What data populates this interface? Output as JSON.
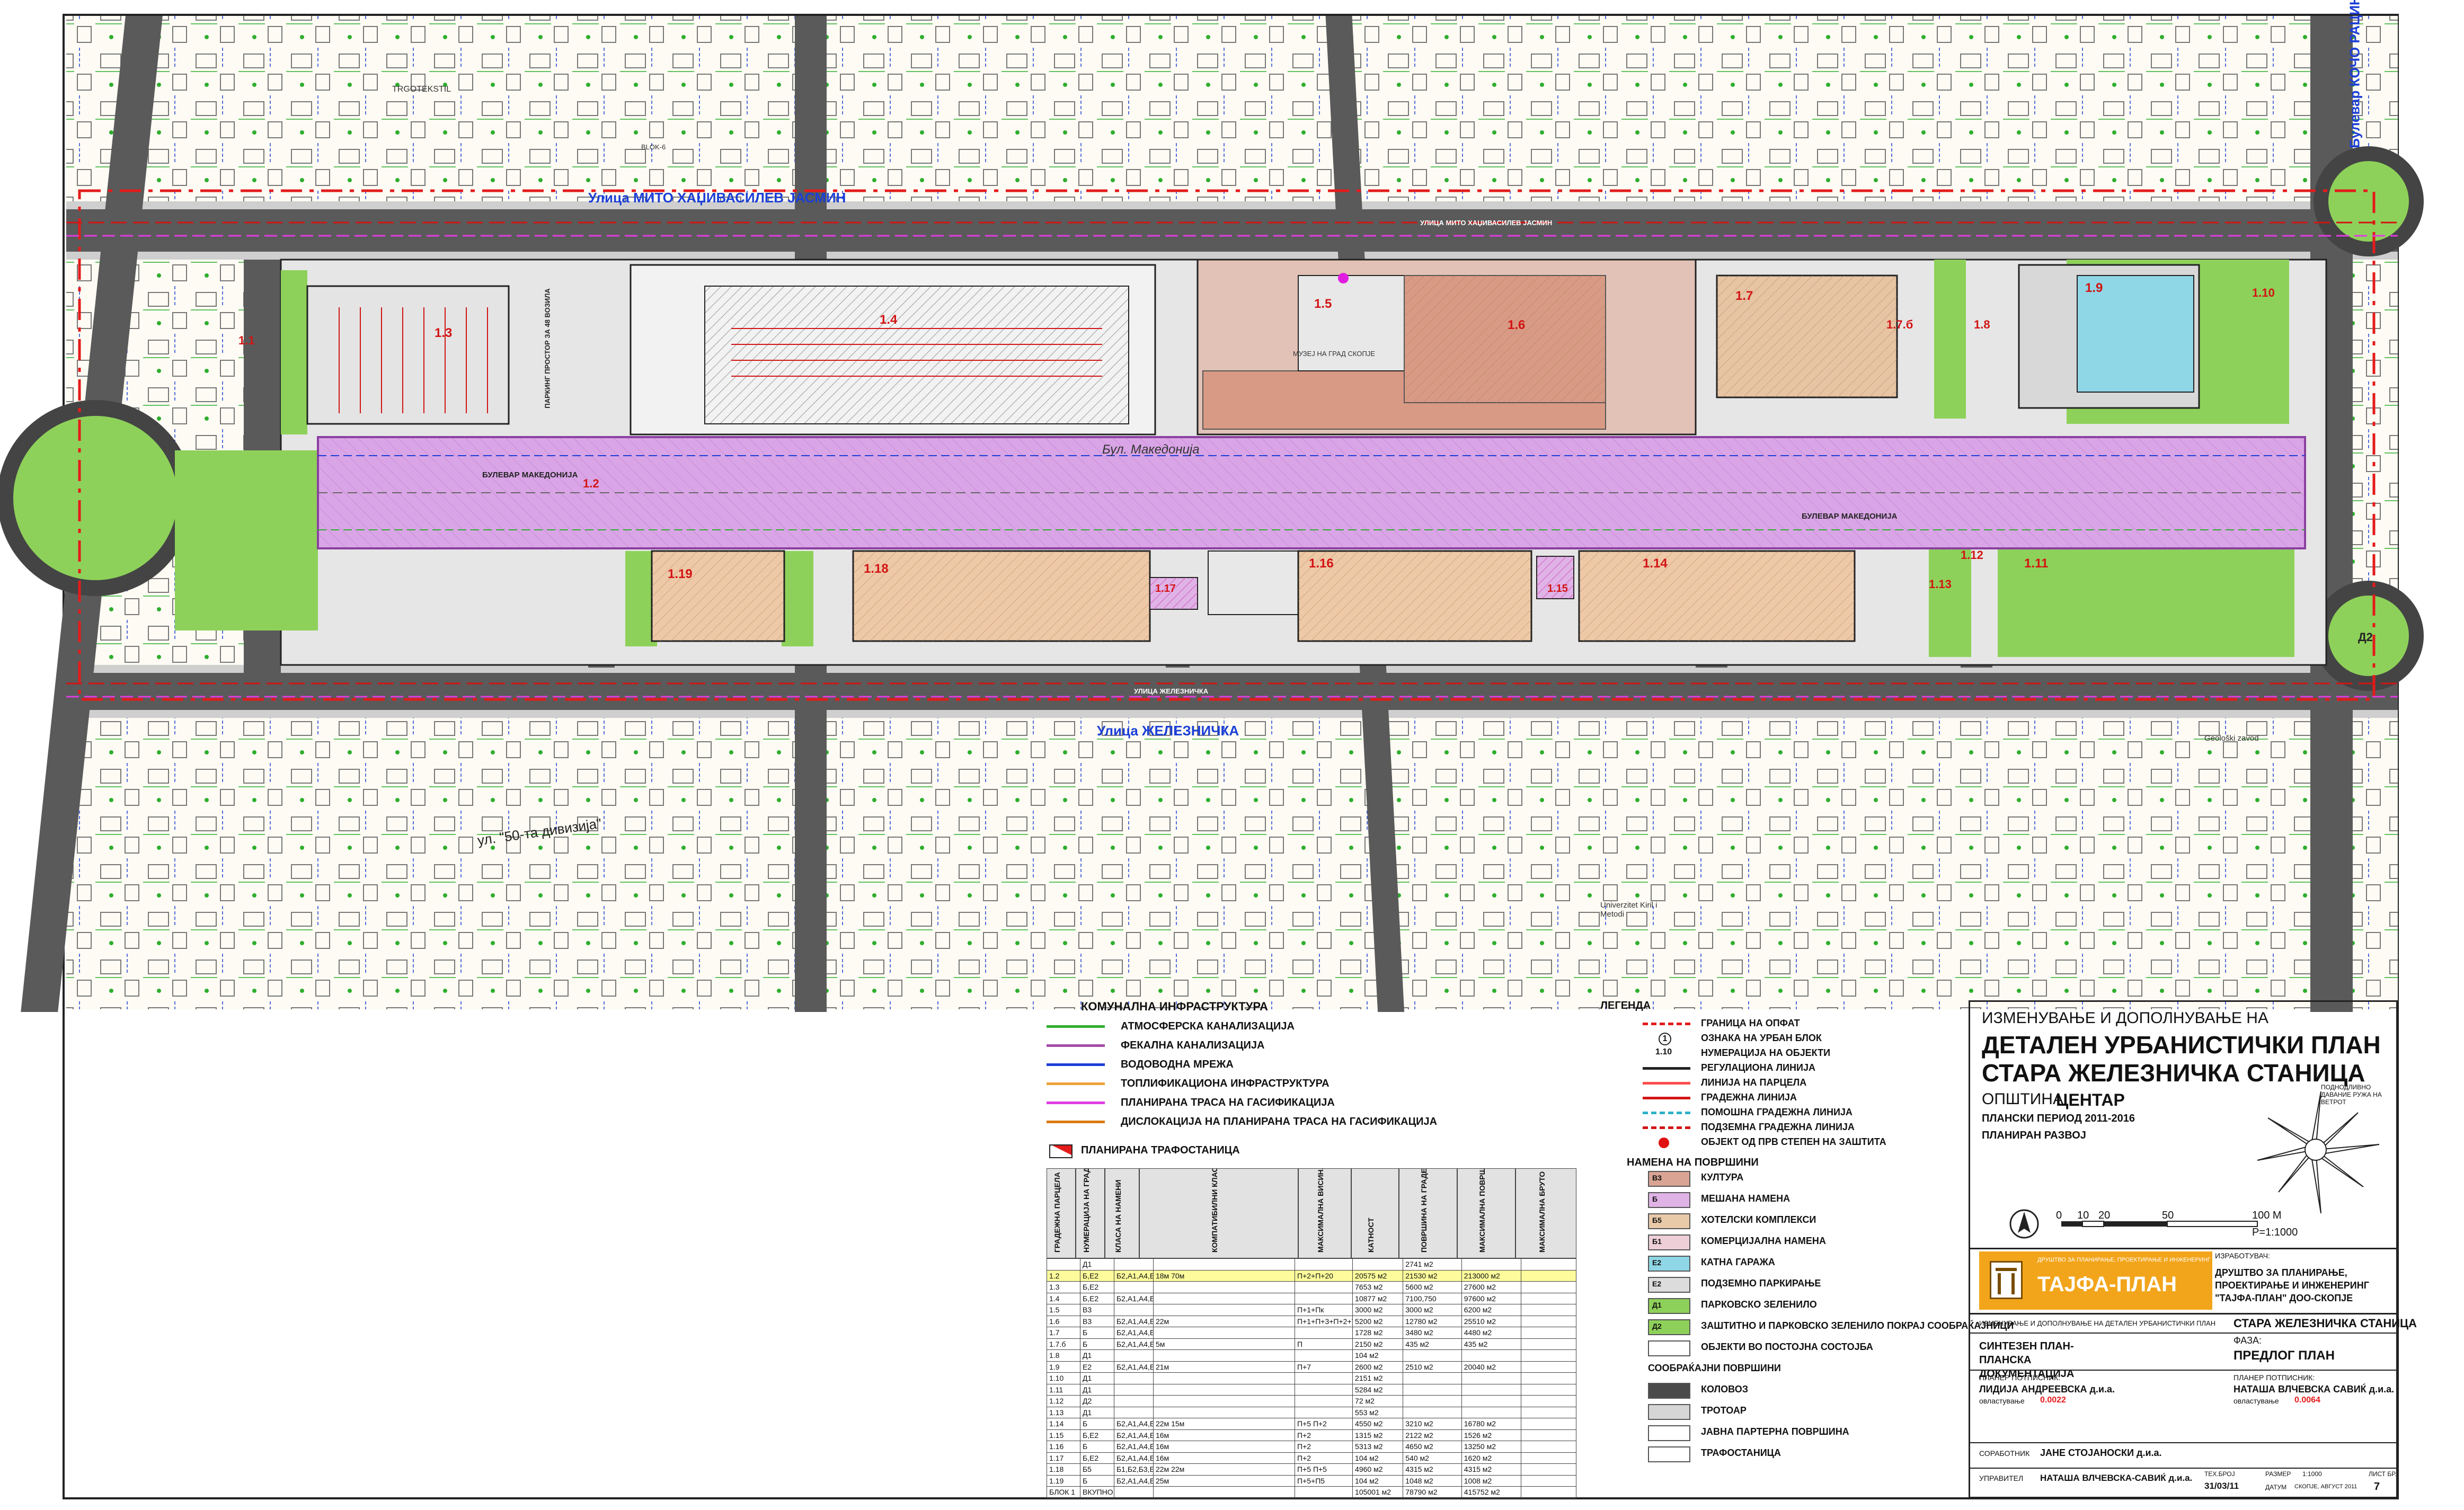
{
  "streets": {
    "north": "Улица МИТО ХАЏИВАСИЛЕВ ЈАСМИН",
    "north_small": "УЛИЦА МИТО ХАЏИВАСИЛЕВ ЈАСМИН",
    "boulevard": "Бул. Македонија",
    "boulevard_caps": "БУЛЕВАР МАКЕДОНИЈА",
    "south": "Улица ЖЕЛЕЗНИЧКА",
    "south_small": "УЛИЦА ЖЕЛЕЗНИЧКА",
    "southwest": "ул. \"50-та дивизија\"",
    "east_blvd": "Булевар КОЧО РАЦИН",
    "west_side": "ПАРКИНГ ПРОСТОР ЗА 48 ВОЗИЛА"
  },
  "map_labels": {
    "trgotekstil": "TRGOTEKSTIL",
    "museum": "МУЗЕЈ НА ГРАД СКОПЈЕ",
    "university": "Univerzitet Kiril i Metodi",
    "geoloski": "Geološki zavod",
    "blok": "BLOK-6"
  },
  "parcels": [
    {
      "id": "1.1",
      "use": "Д1"
    },
    {
      "id": "1.2",
      "use": "Е1"
    },
    {
      "id": "1.3",
      "use": "Б,Е2"
    },
    {
      "id": "1.4",
      "use": "Б"
    },
    {
      "id": "1.5",
      "use": "В3"
    },
    {
      "id": "1.6",
      "use": "В3"
    },
    {
      "id": "1.7",
      "use": "Б"
    },
    {
      "id": "1.7.б",
      "use": "Б"
    },
    {
      "id": "1.8",
      "use": "Д1"
    },
    {
      "id": "1.9",
      "use": "Е2"
    },
    {
      "id": "1.10",
      "use": "Д1"
    },
    {
      "id": "1.11",
      "use": "Д1"
    },
    {
      "id": "1.12",
      "use": "Д1"
    },
    {
      "id": "1.13",
      "use": "Б"
    },
    {
      "id": "1.14",
      "use": "Б"
    },
    {
      "id": "1.15",
      "use": "Б"
    },
    {
      "id": "1.16",
      "use": "Б"
    },
    {
      "id": "1.17",
      "use": "Б"
    },
    {
      "id": "1.18",
      "use": "Б"
    },
    {
      "id": "1.19",
      "use": "Б"
    },
    {
      "id": "Д2",
      "use": "Д2"
    }
  ],
  "infrastructure_legend": {
    "title": "КОМУНАЛНА ИНФРАСТРУКТУРА",
    "items": [
      {
        "label": "АТМОСФЕРСКА КАНАЛИЗАЦИЈА",
        "color": "#2fae2f"
      },
      {
        "label": "ФЕКАЛНА КАНАЛИЗАЦИЈА",
        "color": "#a64ca6"
      },
      {
        "label": "ВОДОВОДНА МРЕЖА",
        "color": "#1c3fd6"
      },
      {
        "label": "ТОПЛИФИКАЦИОНА ИНФРАСТРУКТУРА",
        "color": "#f0a23a"
      },
      {
        "label": "ПЛАНИРАНА ТРАСА НА ГАСИФИКАЦИЈА",
        "color": "#e03ce0"
      },
      {
        "label": "ДИСЛОКАЦИЈА НА ПЛАНИРАНА ТРАСА НА ГАСИФИКАЦИЈА",
        "color": "#d97a10"
      }
    ],
    "trafo": "ПЛАНИРАНА ТРАФОСТАНИЦА"
  },
  "legend": {
    "title": "ЛЕГЕНДА",
    "lines": [
      {
        "label": "ГРАНИЦА НА ОПФАТ",
        "color": "#e41b1b",
        "style": "dashed"
      },
      {
        "label": "ОЗНАКА НА УРБАН БЛОК",
        "symbol": "1"
      },
      {
        "label": "НУМЕРАЦИЈА НА ОБЈЕКТИ",
        "symbol": "1.10"
      },
      {
        "label": "РЕГУЛАЦИОНА ЛИНИЈА",
        "color": "#222222",
        "style": "solid"
      },
      {
        "label": "ЛИНИЈА НА ПАРЦЕЛА",
        "color": "#ff4e4e",
        "style": "solid"
      },
      {
        "label": "ГРАДЕЖНА ЛИНИЈА",
        "color": "#d21414",
        "style": "solid"
      },
      {
        "label": "ПОМОШНА ГРАДЕЖНА ЛИНИЈА",
        "color": "#2fb1c8",
        "style": "dashed"
      },
      {
        "label": "ПОДЗЕМНА ГРАДЕЖНА ЛИНИЈА",
        "color": "#d21414",
        "style": "dashed"
      },
      {
        "label": "ОБЈЕКТ ОД ПРВ СТЕПЕН НА ЗАШТИТА",
        "color": "#e01010",
        "style": "dot"
      }
    ],
    "uses_title": "НАМЕНА НА ПОВРШИНИ",
    "uses": [
      {
        "code": "В3",
        "label": "КУЛТУРА",
        "color": "#d9a494"
      },
      {
        "code": "Б",
        "label": "МЕШАНА НАМЕНА",
        "color": "#e0b3e6"
      },
      {
        "code": "Б5",
        "label": "ХОТЕЛСКИ КОМПЛЕКСИ",
        "color": "#e8c9a8"
      },
      {
        "code": "Б1",
        "label": "КОМЕРЦИЈАЛНА НАМЕНА",
        "color": "#eecfd8"
      },
      {
        "code": "Е2",
        "label": "КАТНА ГАРАЖА",
        "color": "#8fd6e6"
      },
      {
        "code": "Е2",
        "label": "ПОДЗЕМНО ПАРКИРАЊЕ",
        "color": "#dcdcdc"
      },
      {
        "code": "Д1",
        "label": "ПАРКОВСКО ЗЕЛЕНИЛО",
        "color": "#8ed15a"
      },
      {
        "code": "Д2",
        "label": "ЗАШТИТНО И ПАРКОВСКО ЗЕЛЕНИЛО ПОКРАЈ СООБРАЌАЈНИЦИ",
        "color": "#8ed15a"
      },
      {
        "code": "",
        "label": "ОБЈЕКТИ ВО ПОСТОЈНА СОСТОЈБА",
        "color": "#ffffff"
      },
      {
        "code": "",
        "label": "СООБРАЌАЈНИ ПОВРШИНИ",
        "color": ""
      },
      {
        "code": "",
        "label": "КОЛОВОЗ",
        "color": "#4a4a4a"
      },
      {
        "code": "",
        "label": "ТРОТОАР",
        "color": "#d6d6d6"
      },
      {
        "code": "",
        "label": "ЈАВНА ПАРТЕРНА ПОВРШИНА",
        "color": "#ffffff"
      },
      {
        "code": "",
        "label": "ТРАФОСТАНИЦА",
        "color": "#ffffff"
      }
    ]
  },
  "table": {
    "headers": [
      "ГРАДЕЖНА ПАРЦЕЛА",
      "НУМЕРАЦИЈА НА ГРАДЕЖНА ПАРЦЕЛА",
      "КЛАСА НА НАМЕНИ",
      "КОМПАТИБИЛНИ КЛАСИ НА НАМЕНИ",
      "МАКСИМАЛНА ВИСИНА",
      "КАТНОСТ",
      "ПОВРШИНА НА ГРАДЕЖНА ПАРЦЕЛА",
      "МАКСИМАЛНА ПОВРШИНА ЗА ГРАДЕЊЕ",
      "МАКСИМАЛНА БРУТО РАЗВИЕНА ПОВРШИНА"
    ],
    "rows": [
      [
        "",
        "Д1",
        "",
        "",
        "",
        "",
        "2741 м2",
        "",
        ""
      ],
      [
        "1.2",
        "Б,Е2",
        "Б2,А1,А4,Б1,Б2,Б3,Б4,Б5,Б6,Д1 И Д2",
        "18м 70м",
        "П+2+П+20",
        "20575 м2",
        "21530 м2",
        "213000 м2",
        ""
      ],
      [
        "1.3",
        "Б,Е2",
        "",
        "",
        "",
        "7653 м2",
        "5600 м2",
        "27600 м2",
        ""
      ],
      [
        "1.4",
        "Б,Е2",
        "Б2,А1,А4,Б1,Б2,Б3,Б4,Б5,Б6,Д1 И Д2",
        "",
        "",
        "10877 м2",
        "7100,750",
        "97600 м2",
        ""
      ],
      [
        "1.5",
        "В3",
        "",
        "",
        "П+1+Пк",
        "3000 м2",
        "3000 м2",
        "6200 м2",
        ""
      ],
      [
        "1.6",
        "В3",
        "Б2,А1,А4,Б1,Б2,Б3,Б4,Б5,Б6,Д1 И Д2",
        "22м",
        "П+1+П+3+П+2+Т+5",
        "5200 м2",
        "12780 м2",
        "25510 м2",
        ""
      ],
      [
        "1.7",
        "Б",
        "Б2,А1,А4,Б1,Б2,Б3,Б4,Б5,Б6,Д1 И Д2",
        "",
        "",
        "1728 м2",
        "3480 м2",
        "4480 м2",
        ""
      ],
      [
        "1.7.б",
        "Б",
        "Б2,А1,А4,Б1,Б2,Б3,Б4,Б5,Б6,Д1 И Д2",
        "5м",
        "П",
        "2150 м2",
        "435 м2",
        "435 м2",
        ""
      ],
      [
        "1.8",
        "Д1",
        "",
        "",
        "",
        "104 м2",
        "",
        "",
        ""
      ],
      [
        "1.9",
        "Е2",
        "Б2,А1,А4,Б1,Б2,Б3,Б4,Б5,Б6,Д1 И Д2",
        "21м",
        "П+7",
        "2600 м2",
        "2510 м2",
        "20040 м2",
        ""
      ],
      [
        "1.10",
        "Д1",
        "",
        "",
        "",
        "2151 м2",
        "",
        "",
        ""
      ],
      [
        "1.11",
        "Д1",
        "",
        "",
        "",
        "5284 м2",
        "",
        "",
        ""
      ],
      [
        "1.12",
        "Д2",
        "",
        "",
        "",
        "72 м2",
        "",
        "",
        ""
      ],
      [
        "1.13",
        "Д1",
        "",
        "",
        "",
        "553 м2",
        "",
        "",
        ""
      ],
      [
        "1.14",
        "Б",
        "Б2,А1,А4,Б1,Б2,Б3,Б4,Б5,Б6,Д1 И Д2",
        "22м 15м",
        "П+5 П+2",
        "4550 м2",
        "3210 м2",
        "16780 м2",
        ""
      ],
      [
        "1.15",
        "Б,Е2",
        "Б2,А1,А4,Б1,Б2,Б3,Б4,Б5,Б6,Д1 И Д2",
        "16м",
        "П+2",
        "1315 м2",
        "2122 м2",
        "1526 м2",
        ""
      ],
      [
        "1.16",
        "Б",
        "Б2,А1,А4,Б1,Б2,Б3,Б4,Б5,Б6,Д1 И Д2",
        "16м",
        "П+2",
        "5313 м2",
        "4650 м2",
        "13250 м2",
        ""
      ],
      [
        "1.17",
        "Б,Е2",
        "Б2,А1,А4,Б1,Б2,Б3,Б4,Б5,Б6,Д1 И Д2",
        "16м",
        "П+2",
        "104 м2",
        "540 м2",
        "1620 м2",
        ""
      ],
      [
        "1.18",
        "Б5",
        "Б1,Б2,Б3,Б4,Б5,Б6,Д1 И Д2",
        "22м 22м",
        "П+5 П+5",
        "4960 м2",
        "4315 м2",
        "4315 м2",
        ""
      ],
      [
        "1.19",
        "Б",
        "Б2,А1,А4,Б1,Б2,Б3,Б4,Б5,Б6,Д1 И Д2",
        "25м",
        "П+5+П5",
        "104 м2",
        "1048 м2",
        "1008 м2",
        ""
      ],
      [
        "БЛОК 1",
        "ВКУПНО",
        "",
        "",
        "",
        "105001 м2",
        "78790 м2",
        "415752 м2",
        ""
      ]
    ],
    "highlight_row": 1
  },
  "title_block": {
    "line1": "ИЗМЕНУВАЊЕ И ДОПОЛНУВАЊЕ НА",
    "line2": "ДЕТАЛЕН УРБАНИСТИЧКИ ПЛАН",
    "line3": "СТАРА ЖЕЛЕЗНИЧКА СТАНИЦА",
    "municipality_label": "ОПШТИНА",
    "municipality": "ЦЕНТАР",
    "period": "ПЛАНСКИ ПЕРИОД 2011-2016",
    "development": "ПЛАНИРАН РАЗВОЈ",
    "compass_note": "ПОДНОДЛИВНО ДАВАНИЕ РУЖА НА ВЕТРОТ",
    "scale_0": "0",
    "scale_10": "10",
    "scale_20": "20",
    "scale_50": "50",
    "scale_100": "100 M",
    "scale_ratio": "P=1:1000",
    "maker_label": "ИЗРАБОТУВАЧ:",
    "logo_text": "ТАЈФА-ПЛАН",
    "logo_small": "ДРУШТВО ЗА ПЛАНИРАЊЕ, ПРОЕКТИРАЊЕ И ИНЖЕНЕРИНГ",
    "maker_name": "ДРУШТВО ЗА ПЛАНИРАЊЕ, ПРОЕКТИРАЊЕ И ИНЖЕНЕРИНГ \"ТАЈФА-ПЛАН\" ДОО-СКОПЈЕ",
    "project_label": "ИЗМЕНУВАЊЕ И ДОПОЛНУВАЊЕ НА ДЕТАЛЕН УРБАНИСТИЧКИ ПЛАН",
    "project_name": "СТАРА ЖЕЛЕЗНИЧКА СТАНИЦА",
    "phase_label": "ФАЗА:",
    "phase": "ПРЕДЛОГ ПЛАН",
    "sheet_title": "СИНТЕЗЕН ПЛАН- ПЛАНСКА ДОКУМЕНТАЦИЈА",
    "planner1_label": "ПЛАНЕР ПОТПИСНИК:",
    "planner1": "ЛИДИЈА АНДРЕЕВСКА д.и.а.",
    "planner1_lic_label": "овластување",
    "planner1_lic": "0.0022",
    "planner2_label": "ПЛАНЕР ПОТПИСНИК:",
    "planner2": "НАТАША ВЛЧЕВСКА САВИЌ д.и.а.",
    "planner2_lic_label": "овластување",
    "planner2_lic": "0.0064",
    "collab_label": "СОРАБОТНИК",
    "collab": "ЈАНЕ СТОЈАНОСКИ д.и.а.",
    "manager_label": "УПРАВИТЕЛ",
    "manager": "НАТАША ВЛЧЕВСКА-САВИЌ д.и.а.",
    "number_label": "ТЕХ.БРОЈ",
    "number": "31/03/11",
    "scale_label": "РАЗМЕР",
    "scale_value": "1:1000",
    "date_label": "ДАТУМ",
    "date": "СКОПЈЕ, АВГУСТ 2011",
    "sheet_label": "ЛИСТ БР.",
    "sheet_no": "7"
  }
}
